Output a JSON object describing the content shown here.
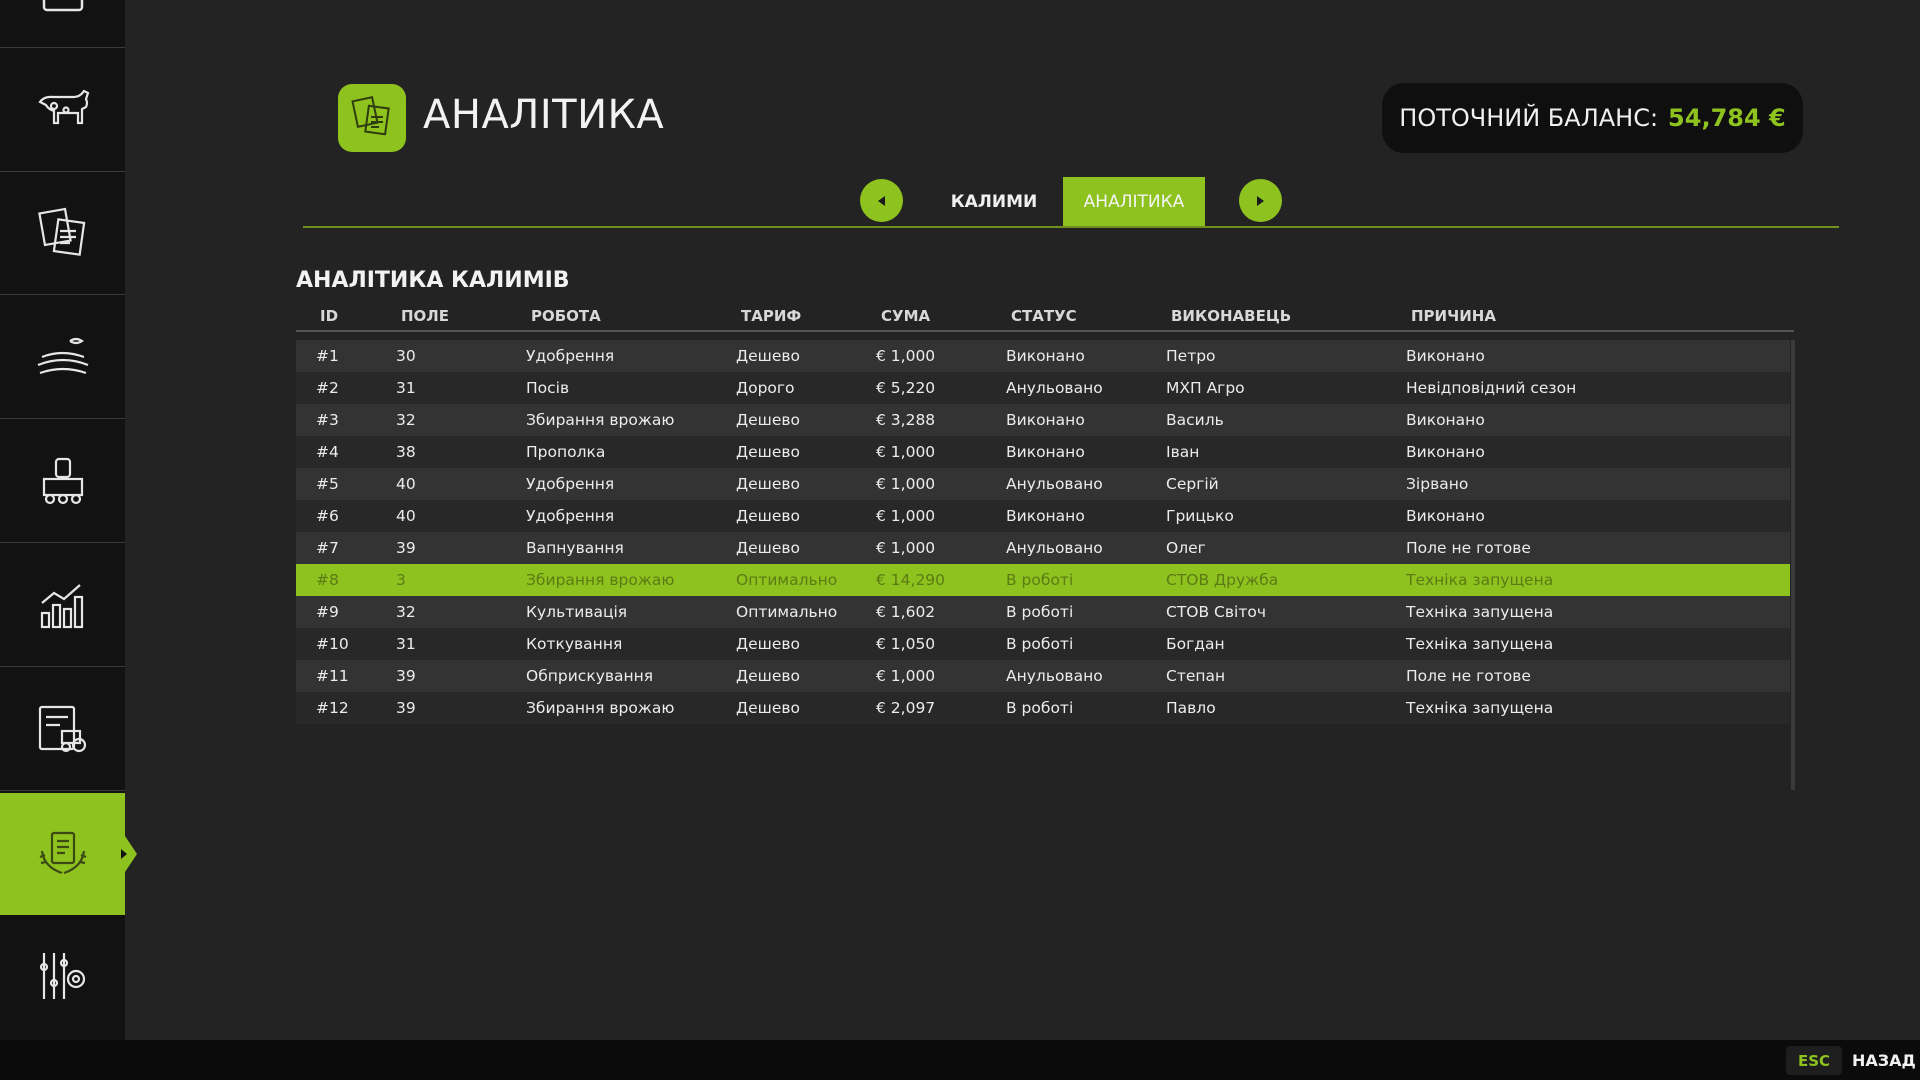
{
  "header": {
    "title": "АНАЛІТИКА",
    "balance_label": "ПОТОЧНИЙ БАЛАНС:",
    "balance_value": "54,784 €"
  },
  "tabs": [
    {
      "label": "КАЛИМИ",
      "active": false
    },
    {
      "label": "АНАЛІТИКА",
      "active": true
    }
  ],
  "section": {
    "title": "АНАЛІТИКА КАЛИМІВ",
    "columns": [
      "ID",
      "ПОЛЕ",
      "РОБОТА",
      "ТАРИФ",
      "СУМА",
      "СТАТУС",
      "ВИКОНАВЕЦЬ",
      "ПРИЧИНА"
    ],
    "rows": [
      {
        "id": "#1",
        "field": "30",
        "work": "Удобрення",
        "tariff": "Дешево",
        "sum": "€ 1,000",
        "status": "Виконано",
        "executor": "Петро",
        "reason": "Виконано"
      },
      {
        "id": "#2",
        "field": "31",
        "work": "Посів",
        "tariff": "Дорого",
        "sum": "€ 5,220",
        "status": "Анульовано",
        "executor": "МХП Агро",
        "reason": "Невідповідний сезон"
      },
      {
        "id": "#3",
        "field": "32",
        "work": "Збирання врожаю",
        "tariff": "Дешево",
        "sum": "€ 3,288",
        "status": "Виконано",
        "executor": "Василь",
        "reason": "Виконано"
      },
      {
        "id": "#4",
        "field": "38",
        "work": "Прополка",
        "tariff": "Дешево",
        "sum": "€ 1,000",
        "status": "Виконано",
        "executor": "Іван",
        "reason": "Виконано"
      },
      {
        "id": "#5",
        "field": "40",
        "work": "Удобрення",
        "tariff": "Дешево",
        "sum": "€ 1,000",
        "status": "Анульовано",
        "executor": "Сергій",
        "reason": "Зірвано"
      },
      {
        "id": "#6",
        "field": "40",
        "work": "Удобрення",
        "tariff": "Дешево",
        "sum": "€ 1,000",
        "status": "Виконано",
        "executor": "Грицько",
        "reason": "Виконано"
      },
      {
        "id": "#7",
        "field": "39",
        "work": "Вапнування",
        "tariff": "Дешево",
        "sum": "€ 1,000",
        "status": "Анульовано",
        "executor": "Олег",
        "reason": "Поле не готове"
      },
      {
        "id": "#8",
        "field": "3",
        "work": "Збирання врожаю",
        "tariff": "Оптимально",
        "sum": "€ 14,290",
        "status": "В роботі",
        "executor": "СТОВ Дружба",
        "reason": "Техніка запущена",
        "selected": true
      },
      {
        "id": "#9",
        "field": "32",
        "work": "Культивація",
        "tariff": "Оптимально",
        "sum": "€ 1,602",
        "status": "В роботі",
        "executor": "СТОВ Світоч",
        "reason": "Техніка запущена"
      },
      {
        "id": "#10",
        "field": "31",
        "work": "Коткування",
        "tariff": "Дешево",
        "sum": "€ 1,050",
        "status": "В роботі",
        "executor": "Богдан",
        "reason": "Техніка запущена"
      },
      {
        "id": "#11",
        "field": "39",
        "work": "Обприскування",
        "tariff": "Дешево",
        "sum": "€ 1,000",
        "status": "Анульовано",
        "executor": "Степан",
        "reason": "Поле не готове"
      },
      {
        "id": "#12",
        "field": "39",
        "work": "Збирання врожаю",
        "tariff": "Дешево",
        "sum": "€ 2,097",
        "status": "В роботі",
        "executor": "Павло",
        "reason": "Техніка запущена"
      }
    ]
  },
  "sidebar": {
    "items": [
      {
        "icon": "map-icon"
      },
      {
        "icon": "cow-icon"
      },
      {
        "icon": "contracts-icon"
      },
      {
        "icon": "field-icon"
      },
      {
        "icon": "production-icon"
      },
      {
        "icon": "statistics-icon"
      },
      {
        "icon": "vehicle-list-icon"
      },
      {
        "icon": "analytics-icon",
        "active": true
      },
      {
        "icon": "settings-icon"
      }
    ]
  },
  "footer": {
    "esc_key": "ESC",
    "back_label": "НАЗАД"
  },
  "colors": {
    "accent": "#8dc21f",
    "background": "#232323",
    "sidebar": "#121212"
  }
}
